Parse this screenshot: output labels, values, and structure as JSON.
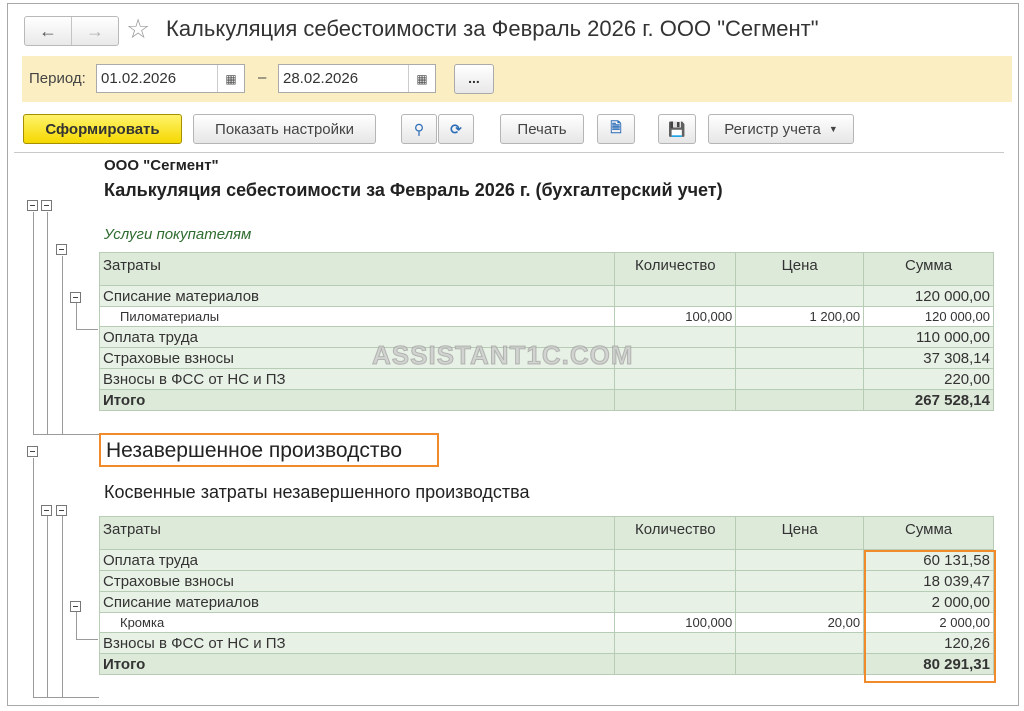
{
  "window": {
    "title": "Калькуляция себестоимости за Февраль 2026 г. ООО \"Сегмент\"",
    "back_icon": "←",
    "forward_icon": "→",
    "favorite_icon": "☆"
  },
  "period": {
    "label": "Период:",
    "from": "01.02.2026",
    "to": "28.02.2026",
    "separator": "–",
    "more_label": "..."
  },
  "toolbar": {
    "generate_label": "Сформировать",
    "settings_label": "Показать настройки",
    "print_label": "Печать",
    "register_label": "Регистр учета",
    "search_icon": "🔍",
    "search_next_icon": "⟳",
    "preview_icon": "preview-icon",
    "save_icon": "💾"
  },
  "report": {
    "organization": "ООО \"Сегмент\"",
    "title": "Калькуляция себестоимости за Февраль 2026 г. (бухгалтерский учет)",
    "section1": {
      "name": "Услуги покупателям",
      "headers": [
        "Затраты",
        "Количество",
        "Цена",
        "Сумма"
      ],
      "rows": [
        {
          "label": "Списание материалов",
          "qty": "",
          "price": "",
          "sum": "120 000,00"
        },
        {
          "label": "Пиломатериалы",
          "qty": "100,000",
          "price": "1 200,00",
          "sum": "120 000,00"
        },
        {
          "label": "Оплата труда",
          "qty": "",
          "price": "",
          "sum": "110 000,00"
        },
        {
          "label": "Страховые взносы",
          "qty": "",
          "price": "",
          "sum": "37 308,14"
        },
        {
          "label": "Взносы в ФСС от НС и ПЗ",
          "qty": "",
          "price": "",
          "sum": "220,00"
        }
      ],
      "total": {
        "label": "Итого",
        "sum": "267 528,14"
      }
    },
    "wip_title": "Незавершенное производство",
    "section2": {
      "name": "Косвенные затраты незавершенного производства",
      "headers": [
        "Затраты",
        "Количество",
        "Цена",
        "Сумма"
      ],
      "rows": [
        {
          "label": "Оплата труда",
          "qty": "",
          "price": "",
          "sum": "60 131,58"
        },
        {
          "label": "Страховые взносы",
          "qty": "",
          "price": "",
          "sum": "18 039,47"
        },
        {
          "label": "Списание материалов",
          "qty": "",
          "price": "",
          "sum": "2 000,00"
        },
        {
          "label": "Кромка",
          "qty": "100,000",
          "price": "20,00",
          "sum": "2 000,00"
        },
        {
          "label": "Взносы в ФСС от НС и ПЗ",
          "qty": "",
          "price": "",
          "sum": "120,26"
        }
      ],
      "total": {
        "label": "Итого",
        "sum": "80 291,31"
      }
    },
    "watermark": "ASSISTANT1C.COM"
  },
  "colors": {
    "period_bg": "#fbeec2",
    "primary_button": "#f5d800",
    "table_header": "#dde9d9",
    "table_row": "#e8f1e5",
    "highlight": "#f08a2a",
    "section_text": "#2e6b2e"
  }
}
